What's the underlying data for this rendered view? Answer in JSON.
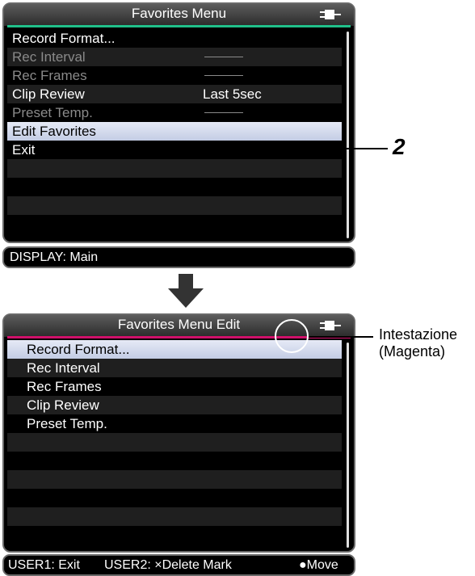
{
  "top_screen": {
    "title": "Favorites Menu",
    "title_underline_color": "#20c08a",
    "items": [
      {
        "label": "Record Format...",
        "value": "",
        "state": "normal"
      },
      {
        "label": "Rec Interval",
        "value": "",
        "state": "disabled",
        "value_placeholder": "dash"
      },
      {
        "label": "Rec Frames",
        "value": "",
        "state": "disabled",
        "value_placeholder": "dash"
      },
      {
        "label": "Clip Review",
        "value": "Last 5sec",
        "state": "normal"
      },
      {
        "label": "Preset Temp.",
        "value": "",
        "state": "disabled",
        "value_placeholder": "dash"
      },
      {
        "label": "Edit Favorites",
        "value": "",
        "state": "selected"
      },
      {
        "label": "Exit",
        "value": "",
        "state": "normal"
      }
    ],
    "status": "DISPLAY: Main",
    "battery_icon": "plug-icon"
  },
  "bottom_screen": {
    "title": "Favorites Menu Edit",
    "title_underline_color": "#d0106a",
    "items": [
      {
        "label": "Record Format...",
        "state": "selected"
      },
      {
        "label": "Rec Interval",
        "state": "normal"
      },
      {
        "label": "Rec Frames",
        "state": "normal"
      },
      {
        "label": "Clip Review",
        "state": "normal"
      },
      {
        "label": "Preset Temp.",
        "state": "normal"
      }
    ],
    "status": {
      "user1": "USER1: Exit",
      "user2": "USER2: ×Delete Mark",
      "move": "●Move"
    },
    "battery_icon": "plug-icon"
  },
  "callouts": {
    "step_number": "2",
    "header_label_line1": "Intestazione",
    "header_label_line2": "(Magenta)"
  },
  "transition_icon": "down-arrow-icon"
}
